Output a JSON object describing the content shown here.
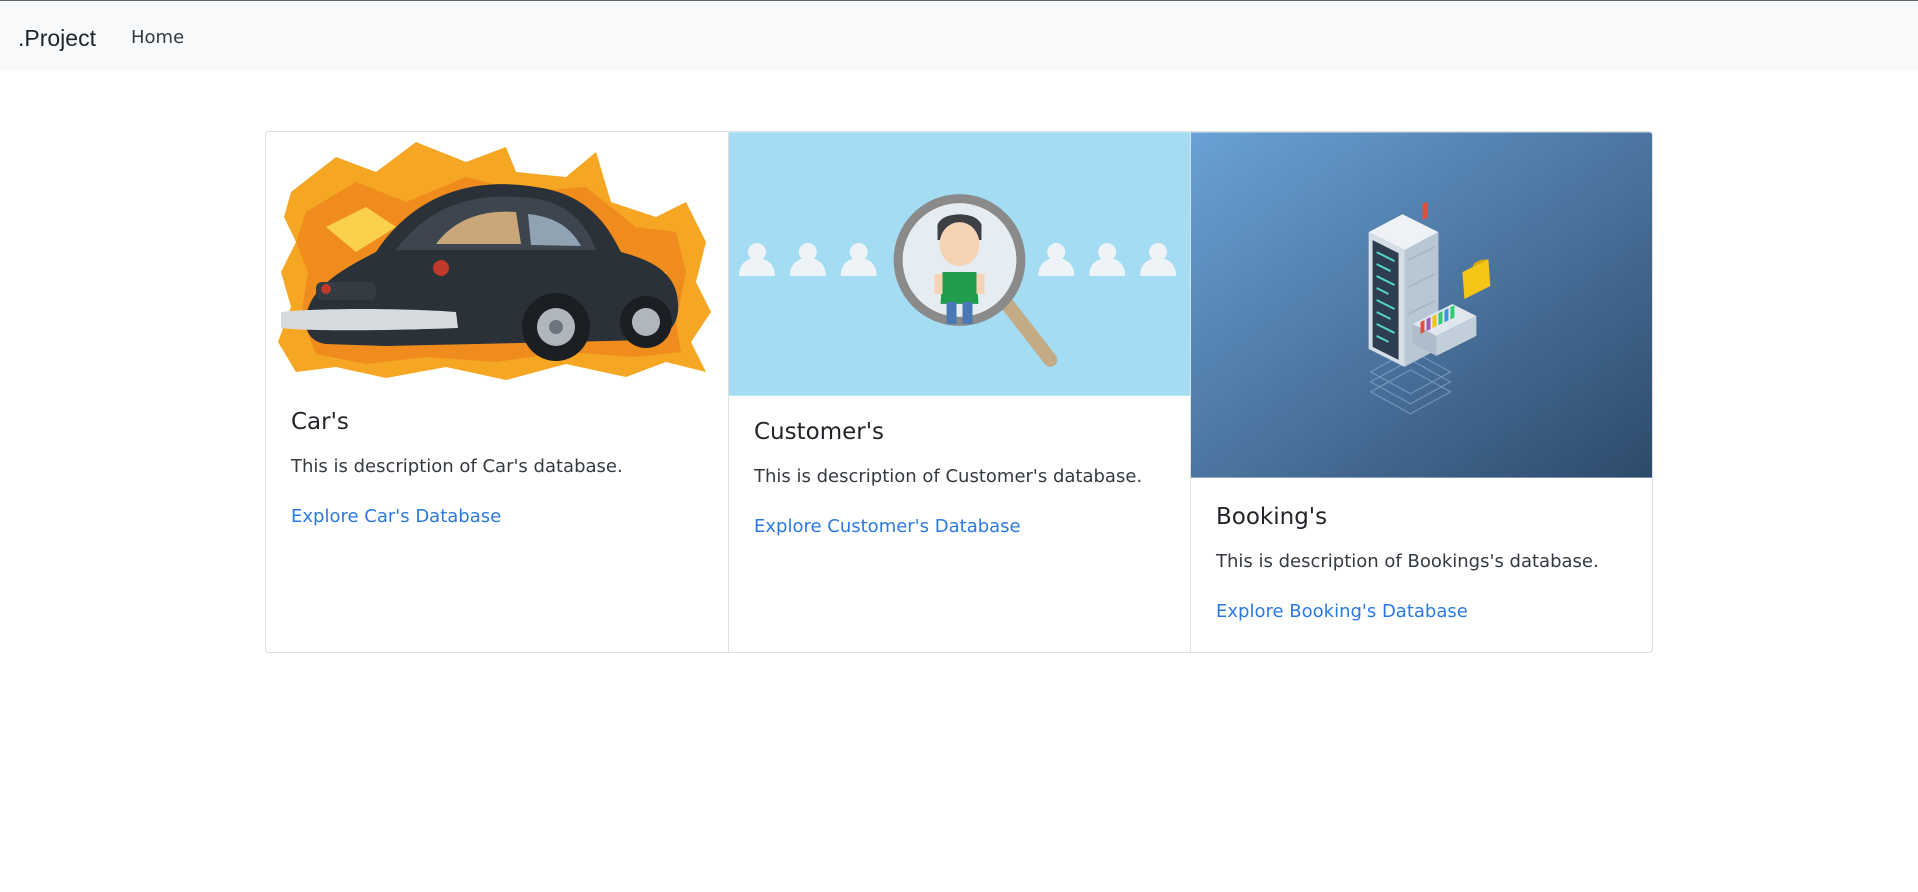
{
  "navbar": {
    "brand": ".Project",
    "links": [
      {
        "label": "Home"
      }
    ]
  },
  "cards": [
    {
      "title": "Car's",
      "description": "This is description of Car's database.",
      "link_label": "Explore Car's Database",
      "image": "car-image"
    },
    {
      "title": "Customer's",
      "description": "This is description of Customer's database.",
      "link_label": "Explore Customer's Database",
      "image": "customer-search-image"
    },
    {
      "title": "Booking's",
      "description": "This is description of Bookings's database.",
      "link_label": "Explore Booking's Database",
      "image": "database-server-image"
    }
  ],
  "colors": {
    "link": "#2a7ae2",
    "navbar_bg": "#f8f9fa",
    "customer_bg": "#a3dcf3",
    "booking_bg_start": "#6aa1d6",
    "booking_bg_end": "#2d4a6b"
  }
}
